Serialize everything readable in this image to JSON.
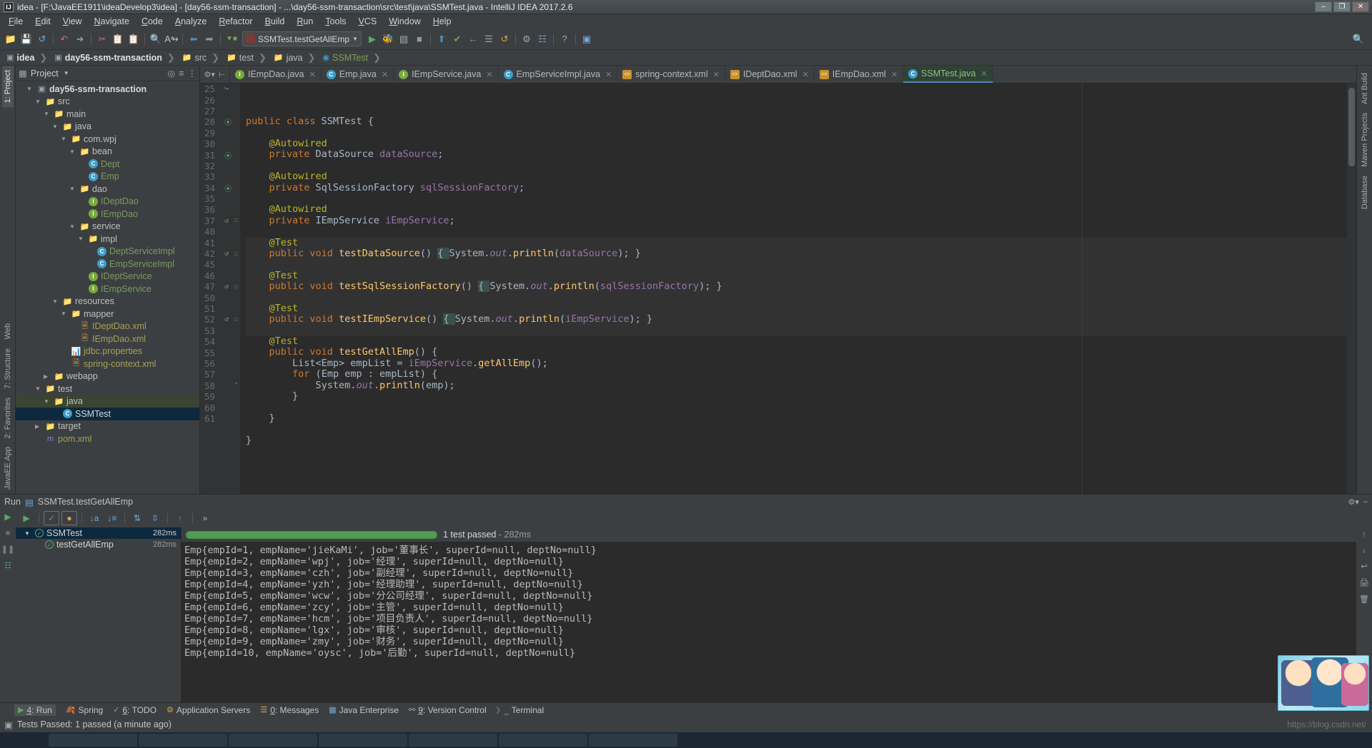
{
  "window": {
    "title": "idea - [F:\\JavaEE1911\\ideaDevelop3\\idea] - [day56-ssm-transaction] - ...\\day56-ssm-transaction\\src\\test\\java\\SSMTest.java - IntelliJ IDEA 2017.2.6",
    "logo": "IJ",
    "minimize": "–",
    "maximize": "❐",
    "close": "✕"
  },
  "menu": [
    "File",
    "Edit",
    "View",
    "Navigate",
    "Code",
    "Analyze",
    "Refactor",
    "Build",
    "Run",
    "Tools",
    "VCS",
    "Window",
    "Help"
  ],
  "toolbar": {
    "run_config": "SSMTest.testGetAllEmp",
    "icons": [
      "open-folder-icon",
      "save-icon",
      "sync-icon",
      "undo-icon",
      "redo-icon",
      "cut-icon",
      "copy-icon",
      "paste-icon",
      "find-icon",
      "replace-icon",
      "back-icon",
      "forward-icon",
      "compile-icon",
      "run-icon",
      "debug-icon",
      "stop-icon",
      "coverage-icon",
      "profile-icon",
      "update-project-icon",
      "commit-icon",
      "rollback-icon",
      "settings-icon",
      "structure-icon",
      "help-icon",
      "project-structure-icon",
      "search-everywhere-icon"
    ]
  },
  "breadcrumb": [
    {
      "label": "idea",
      "icon": "module-icon",
      "bold": true
    },
    {
      "label": "day56-ssm-transaction",
      "icon": "module-icon",
      "bold": true
    },
    {
      "label": "src",
      "icon": "folder-icon",
      "bold": false
    },
    {
      "label": "test",
      "icon": "folder-icon",
      "bold": false
    },
    {
      "label": "java",
      "icon": "test-source-folder-icon",
      "bold": false
    },
    {
      "label": "SSMTest",
      "icon": "class-icon",
      "bold": false,
      "green": true
    }
  ],
  "left_strip": [
    {
      "label": "1: Project",
      "selected": true,
      "icon": "project-icon"
    },
    {
      "label": "Web",
      "selected": false,
      "icon": "web-icon"
    },
    {
      "label": "7: Structure",
      "selected": false,
      "icon": "structure-icon"
    },
    {
      "label": "2: Favorites",
      "selected": false,
      "icon": "star-icon"
    },
    {
      "label": "JavaEE App",
      "selected": false,
      "icon": "javaee-icon"
    }
  ],
  "right_strip": [
    {
      "label": "Ant Build",
      "icon": "ant-icon"
    },
    {
      "label": "Maven Projects",
      "icon": "maven-icon"
    },
    {
      "label": "Database",
      "icon": "database-icon"
    }
  ],
  "project_panel": {
    "title": "Project",
    "caret": "▼",
    "actions": [
      "target-icon",
      "collapse-all-icon",
      "settings-icon",
      "hide-icon"
    ],
    "tree": [
      {
        "label": "day56-ssm-transaction",
        "depth": 1,
        "twisty": "▼",
        "icon": "module",
        "style": "bold"
      },
      {
        "label": "src",
        "depth": 2,
        "twisty": "▼",
        "icon": "folder",
        "style": ""
      },
      {
        "label": "main",
        "depth": 3,
        "twisty": "▼",
        "icon": "folder-src",
        "style": ""
      },
      {
        "label": "java",
        "depth": 4,
        "twisty": "▼",
        "icon": "folder-blue",
        "style": ""
      },
      {
        "label": "com.wpj",
        "depth": 5,
        "twisty": "▼",
        "icon": "package",
        "style": ""
      },
      {
        "label": "bean",
        "depth": 6,
        "twisty": "▼",
        "icon": "package",
        "style": ""
      },
      {
        "label": "Dept",
        "depth": 7,
        "twisty": "",
        "icon": "class",
        "style": "cls"
      },
      {
        "label": "Emp",
        "depth": 7,
        "twisty": "",
        "icon": "class",
        "style": "cls"
      },
      {
        "label": "dao",
        "depth": 6,
        "twisty": "▼",
        "icon": "package",
        "style": ""
      },
      {
        "label": "IDeptDao",
        "depth": 7,
        "twisty": "",
        "icon": "interface",
        "style": "iface"
      },
      {
        "label": "IEmpDao",
        "depth": 7,
        "twisty": "",
        "icon": "interface",
        "style": "iface"
      },
      {
        "label": "service",
        "depth": 6,
        "twisty": "▼",
        "icon": "package",
        "style": ""
      },
      {
        "label": "impl",
        "depth": 7,
        "twisty": "▼",
        "icon": "package",
        "style": ""
      },
      {
        "label": "DeptServiceImpl",
        "depth": 8,
        "twisty": "",
        "icon": "class",
        "style": "cls"
      },
      {
        "label": "EmpServiceImpl",
        "depth": 8,
        "twisty": "",
        "icon": "class",
        "style": "cls"
      },
      {
        "label": "IDeptService",
        "depth": 7,
        "twisty": "",
        "icon": "interface",
        "style": "iface"
      },
      {
        "label": "IEmpService",
        "depth": 7,
        "twisty": "",
        "icon": "interface",
        "style": "iface"
      },
      {
        "label": "resources",
        "depth": 4,
        "twisty": "▼",
        "icon": "resources",
        "style": ""
      },
      {
        "label": "mapper",
        "depth": 5,
        "twisty": "▼",
        "icon": "package",
        "style": ""
      },
      {
        "label": "IDeptDao.xml",
        "depth": 6,
        "twisty": "",
        "icon": "xml",
        "style": "xml"
      },
      {
        "label": "IEmpDao.xml",
        "depth": 6,
        "twisty": "",
        "icon": "xml",
        "style": "xml"
      },
      {
        "label": "jdbc.properties",
        "depth": 5,
        "twisty": "",
        "icon": "properties",
        "style": "props"
      },
      {
        "label": "spring-context.xml",
        "depth": 5,
        "twisty": "",
        "icon": "xml",
        "style": "xml"
      },
      {
        "label": "webapp",
        "depth": 3,
        "twisty": "▶",
        "icon": "folder",
        "style": ""
      },
      {
        "label": "test",
        "depth": 2,
        "twisty": "▼",
        "icon": "folder",
        "style": ""
      },
      {
        "label": "java",
        "depth": 3,
        "twisty": "▼",
        "icon": "folder-test",
        "style": "",
        "row": "green-row"
      },
      {
        "label": "SSMTest",
        "depth": 4,
        "twisty": "",
        "icon": "class",
        "style": "",
        "row": "sel"
      },
      {
        "label": "target",
        "depth": 2,
        "twisty": "▶",
        "icon": "folder",
        "style": ""
      },
      {
        "label": "pom.xml",
        "depth": 2,
        "twisty": "",
        "icon": "maven",
        "style": "xml"
      }
    ]
  },
  "editor_tabs": [
    {
      "label": "IEmpDao.java",
      "icon": "interface-icon",
      "active": false
    },
    {
      "label": "Emp.java",
      "icon": "class-icon",
      "active": false
    },
    {
      "label": "IEmpService.java",
      "icon": "interface-icon",
      "active": false
    },
    {
      "label": "EmpServiceImpl.java",
      "icon": "class-icon",
      "active": false
    },
    {
      "label": "spring-context.xml",
      "icon": "xml-icon",
      "active": false
    },
    {
      "label": "IDeptDao.xml",
      "icon": "xml-icon",
      "active": false
    },
    {
      "label": "IEmpDao.xml",
      "icon": "xml-icon",
      "active": false
    },
    {
      "label": "SSMTest.java",
      "icon": "class-icon",
      "active": true
    }
  ],
  "code": {
    "lines": [
      {
        "num": "25",
        "mark": "impl",
        "html": "<span class=\"kw\">public class </span><span class=\"typ\">SSMTest </span><span class=\"pun\">{</span>"
      },
      {
        "num": "26",
        "mark": "",
        "html": ""
      },
      {
        "num": "27",
        "mark": "",
        "html": "    <span class=\"ann\">@Autowired</span>"
      },
      {
        "num": "28",
        "mark": "bean",
        "html": "    <span class=\"kw\">private </span><span class=\"typ\">DataSource </span><span class=\"fld\">dataSource</span><span class=\"pun\">;</span>"
      },
      {
        "num": "29",
        "mark": "",
        "html": ""
      },
      {
        "num": "30",
        "mark": "",
        "html": "    <span class=\"ann\">@Autowired</span>"
      },
      {
        "num": "31",
        "mark": "bean",
        "html": "    <span class=\"kw\">private </span><span class=\"typ\">SqlSessionFactory </span><span class=\"fld\">sqlSessionFactory</span><span class=\"pun\">;</span>"
      },
      {
        "num": "32",
        "mark": "",
        "html": ""
      },
      {
        "num": "33",
        "mark": "",
        "html": "    <span class=\"ann\">@Autowired</span>"
      },
      {
        "num": "34",
        "mark": "bean",
        "html": "    <span class=\"kw\">private </span><span class=\"typ\">IEmpService </span><span class=\"fld\">iEmpService</span><span class=\"pun\">;</span>"
      },
      {
        "num": "35",
        "mark": "",
        "html": ""
      },
      {
        "num": "36",
        "mark": "",
        "hl": true,
        "html": "    <span class=\"ann\">@Test</span>"
      },
      {
        "num": "37",
        "mark": "run",
        "fold": "+",
        "hl": true,
        "html": "    <span class=\"kw\">public void </span><span class=\"fn\">testDataSource</span><span class=\"pun\">() </span><span class=\"brace-hl\">{ </span><span class=\"typ\">System.</span><span class=\"it\">out</span><span class=\"typ\">.</span><span class=\"fn\">println</span><span class=\"pun\">(</span><span class=\"fld\">dataSource</span><span class=\"pun\">); }</span>"
      },
      {
        "num": "40",
        "mark": "",
        "hl": true,
        "html": ""
      },
      {
        "num": "41",
        "mark": "",
        "hl": true,
        "html": "    <span class=\"ann\">@Test</span>"
      },
      {
        "num": "42",
        "mark": "run",
        "fold": "+",
        "hl": true,
        "html": "    <span class=\"kw\">public void </span><span class=\"fn\">testSqlSessionFactory</span><span class=\"pun\">() </span><span class=\"brace-hl\">{ </span><span class=\"typ\">System.</span><span class=\"it\">out</span><span class=\"typ\">.</span><span class=\"fn\">println</span><span class=\"pun\">(</span><span class=\"fld\">sqlSessionFactory</span><span class=\"pun\">); }</span>"
      },
      {
        "num": "45",
        "mark": "",
        "hl": true,
        "html": ""
      },
      {
        "num": "46",
        "mark": "",
        "hl": true,
        "html": "    <span class=\"ann\">@Test</span>"
      },
      {
        "num": "47",
        "mark": "run",
        "fold": "+",
        "hl": true,
        "html": "    <span class=\"kw\">public void </span><span class=\"fn\">testIEmpService</span><span class=\"pun\">() </span><span class=\"brace-hl\">{ </span><span class=\"typ\">System.</span><span class=\"it\">out</span><span class=\"typ\">.</span><span class=\"fn\">println</span><span class=\"pun\">(</span><span class=\"fld\">iEmpService</span><span class=\"pun\">); }</span>"
      },
      {
        "num": "50",
        "mark": "",
        "hl": true,
        "html": ""
      },
      {
        "num": "51",
        "mark": "",
        "html": "    <span class=\"ann\">@Test</span>"
      },
      {
        "num": "52",
        "mark": "run",
        "fold": "-",
        "html": "    <span class=\"kw\">public void </span><span class=\"fn\">testGetAllEmp</span><span class=\"pun\">() {</span>"
      },
      {
        "num": "53",
        "mark": "",
        "html": "        <span class=\"typ\">List&lt;Emp&gt; empList </span><span class=\"pun\">= </span><span class=\"fld\">iEmpService</span><span class=\"pun\">.</span><span class=\"fn\">getAllEmp</span><span class=\"pun\">();</span>"
      },
      {
        "num": "54",
        "mark": "",
        "html": "        <span class=\"kw\">for </span><span class=\"pun\">(</span><span class=\"typ\">Emp emp </span><span class=\"pun\">: </span><span class=\"typ\">empList</span><span class=\"pun\">) {</span>"
      },
      {
        "num": "55",
        "mark": "",
        "html": "            <span class=\"typ\">System.</span><span class=\"it\">out</span><span class=\"typ\">.</span><span class=\"fn\">println</span><span class=\"pun\">(emp);</span>"
      },
      {
        "num": "56",
        "mark": "",
        "html": "        <span class=\"pun\">}</span>"
      },
      {
        "num": "57",
        "mark": "",
        "html": ""
      },
      {
        "num": "58",
        "mark": "fold",
        "html": "    <span class=\"pun\">}</span>"
      },
      {
        "num": "59",
        "mark": "",
        "html": ""
      },
      {
        "num": "60",
        "mark": "",
        "html": "<span class=\"pun\">}</span>"
      },
      {
        "num": "61",
        "mark": "",
        "html": ""
      }
    ]
  },
  "run_panel": {
    "header_label": "Run",
    "header_config": "SSMTest.testGetAllEmp",
    "toolbar_icons": [
      "rerun-icon",
      "show-passed-icon",
      "show-ignored-icon",
      "sort-alpha-icon",
      "sort-duration-icon",
      "expand-all-icon",
      "collapse-all-icon",
      "export-icon",
      "more-icon"
    ],
    "left_icons": [
      "rerun-icon",
      "stop-icon",
      "pause-icon",
      "thread-dump-icon"
    ],
    "side_icons": [
      "scroll-up-icon",
      "scroll-down-icon",
      "soft-wrap-icon",
      "print-icon",
      "clear-all-icon"
    ],
    "tests": [
      {
        "label": "SSMTest",
        "time": "282ms",
        "twisty": "▼",
        "selected": true,
        "status": "passed",
        "depth": 0
      },
      {
        "label": "testGetAllEmp",
        "time": "282ms",
        "twisty": "",
        "selected": false,
        "status": "passed",
        "depth": 1
      }
    ],
    "status": {
      "text": "1 test passed",
      "dash": "-",
      "time": "282ms",
      "progress": 100
    },
    "console_output": [
      "Emp{empId=1, empName='jieKaMi', job='董事长', superId=null, deptNo=null}",
      "Emp{empId=2, empName='wpj', job='经理', superId=null, deptNo=null}",
      "Emp{empId=3, empName='czh', job='副经理', superId=null, deptNo=null}",
      "Emp{empId=4, empName='yzh', job='经理助理', superId=null, deptNo=null}",
      "Emp{empId=5, empName='wcw', job='分公司经理', superId=null, deptNo=null}",
      "Emp{empId=6, empName='zcy', job='主管', superId=null, deptNo=null}",
      "Emp{empId=7, empName='hcm', job='项目负责人', superId=null, deptNo=null}",
      "Emp{empId=8, empName='lgx', job='审核', superId=null, deptNo=null}",
      "Emp{empId=9, empName='zmy', job='财务', superId=null, deptNo=null}",
      "Emp{empId=10, empName='oysc', job='后勤', superId=null, deptNo=null}"
    ]
  },
  "bottom_toolwindows": [
    {
      "label": "4: Run",
      "icon": "run-icon",
      "selected": true
    },
    {
      "label": "Spring",
      "icon": "spring-icon",
      "selected": false
    },
    {
      "label": "6: TODO",
      "icon": "todo-icon",
      "selected": false
    },
    {
      "label": "Application Servers",
      "icon": "app-servers-icon",
      "selected": false
    },
    {
      "label": "0: Messages",
      "icon": "messages-icon",
      "selected": false
    },
    {
      "label": "Java Enterprise",
      "icon": "javaee-icon",
      "selected": false
    },
    {
      "label": "9: Version Control",
      "icon": "vcs-icon",
      "selected": false
    },
    {
      "label": "Terminal",
      "icon": "terminal-icon",
      "selected": false
    }
  ],
  "statusbar": {
    "text": "Tests Passed: 1 passed (a minute ago)",
    "icon": "event-log-icon",
    "watermark": "https://blog.csdn.net/"
  }
}
